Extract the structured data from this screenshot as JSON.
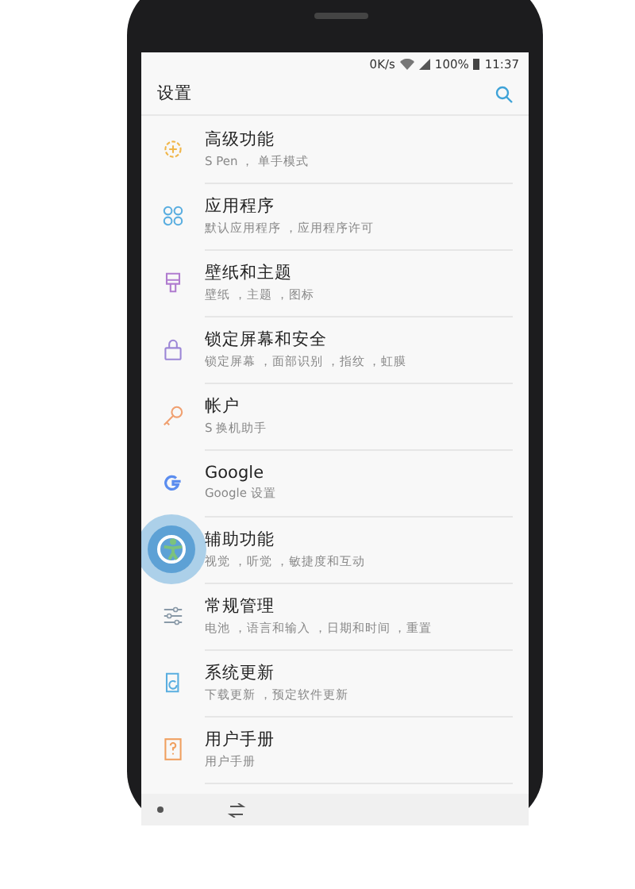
{
  "status_bar": {
    "speed": "0K/s",
    "battery": "100%",
    "time": "11:37"
  },
  "header": {
    "title": "设置"
  },
  "items": [
    {
      "title": "高级功能",
      "summary": "S Pen ， 单手模式",
      "kind": "gear",
      "color": "#f0b64a"
    },
    {
      "title": "应用程序",
      "summary": "默认应用程序 ，应用程序许可",
      "kind": "apps",
      "color": "#5aaee0"
    },
    {
      "title": "壁纸和主题",
      "summary": "壁纸 ，主题 ，图标",
      "kind": "brush",
      "color": "#b07ccf"
    },
    {
      "title": "锁定屏幕和安全",
      "summary": "锁定屏幕 ，面部识别 ，指纹 ，虹膜",
      "kind": "lock",
      "color": "#9c86d6"
    },
    {
      "title": "帐户",
      "summary": "S 换机助手",
      "kind": "key",
      "color": "#f0a070"
    },
    {
      "title": "Google",
      "summary": "Google 设置",
      "kind": "google",
      "color": "#5b8def"
    },
    {
      "title": "辅助功能",
      "summary": "视觉 ，听觉 ，敏捷度和互动",
      "kind": "person",
      "color": "#7cc27c",
      "touched": true
    },
    {
      "title": "常规管理",
      "summary": "电池 ，语言和输入 ，日期和时间 ，重置",
      "kind": "sliders",
      "color": "#8a9aa8"
    },
    {
      "title": "系统更新",
      "summary": "下载更新 ，预定软件更新",
      "kind": "update",
      "color": "#5aaee0"
    },
    {
      "title": "用户手册",
      "summary": "用户手册",
      "kind": "manual",
      "color": "#f0a060"
    }
  ]
}
